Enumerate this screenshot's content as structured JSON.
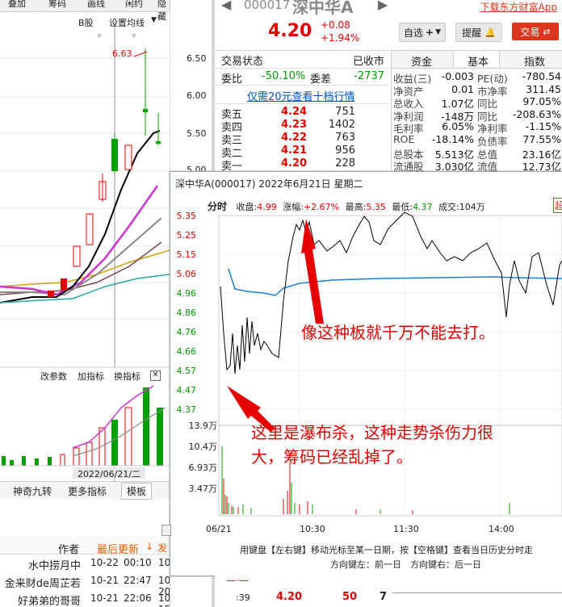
{
  "left": {
    "top_tabs": [
      "叠加",
      "筹码",
      "画线",
      "闲约",
      "隐藏"
    ],
    "b_label": "B股",
    "set_ma_label": "设置均线",
    "price_ticks": [
      "6.50",
      "6.00",
      "5.50",
      "5.00"
    ],
    "high_label": "6.63",
    "indicator_tabs": [
      "改参数",
      "加指标",
      "换指标"
    ],
    "date_label": "2022/06/21/二",
    "bottom_tabs": [
      "神奇九转",
      "更多指标",
      "模板"
    ],
    "comments_header": {
      "author": "作者",
      "latest": "最后更新"
    },
    "comments": [
      {
        "author": "水中捞月中",
        "date": "10-22",
        "time": "00:10",
        "extra": "10-"
      },
      {
        "author": "金来财de周芷若",
        "date": "10-21",
        "time": "22:47",
        "extra": "10-20"
      },
      {
        "author": "好弟弟的哥哥",
        "date": "10-21",
        "time": "22:06",
        "extra": "10-15"
      }
    ]
  },
  "header": {
    "code": "000017",
    "name": "深中华A",
    "download": "下载东方财富App",
    "price": "4.20",
    "change": "+0.08",
    "change_pct": "+1.94%",
    "btn_watch": "自选",
    "btn_alert": "提醒",
    "btn_trade": "交易"
  },
  "status": {
    "label": "交易状态",
    "value": "已收市",
    "wei_bi_label": "委比",
    "wei_bi": "-50.10%",
    "wei_cha_label": "委差",
    "wei_cha": "-2737",
    "link": "仅需20元查看十档行情"
  },
  "asks": [
    {
      "label": "卖五",
      "price": "4.24",
      "vol": "751"
    },
    {
      "label": "卖四",
      "price": "4.23",
      "vol": "1402"
    },
    {
      "label": "卖三",
      "price": "4.22",
      "vol": "763"
    },
    {
      "label": "卖二",
      "price": "4.21",
      "vol": "956"
    },
    {
      "label": "卖一",
      "price": "4.20",
      "vol": "228"
    }
  ],
  "info_tabs": [
    "资金",
    "基本",
    "指数"
  ],
  "fundamentals": [
    {
      "k1": "收益(三)",
      "v1": "-0.003",
      "k2": "PE(动)",
      "v2": "-780.54"
    },
    {
      "k1": "净资产",
      "v1": "0.01",
      "k2": "市净率",
      "v2": "311.45"
    },
    {
      "k1": "总收入",
      "v1": "1.07亿",
      "k2": "同比",
      "v2": "97.05%"
    },
    {
      "k1": "净利润",
      "v1": "-148万",
      "k2": "同比",
      "v2": "-208.63%"
    },
    {
      "k1": "毛利率",
      "v1": "6.05%",
      "k2": "净利率",
      "v2": "-1.15%"
    },
    {
      "k1": "ROE",
      "v1": "-18.14%",
      "k2": "负债率",
      "v2": "77.55%"
    },
    {
      "k1": "总股本",
      "v1": "5.513亿",
      "k2": "总值",
      "v2": "23.16亿"
    },
    {
      "k1": "流通股",
      "v1": "3.030亿",
      "k2": "流值",
      "v2": "12.73亿"
    }
  ],
  "popup": {
    "title": "深中华A(000017) 2022年6月21日 星期二",
    "fenshi": "分时",
    "close_label": "收盘:",
    "close": "4.99",
    "chg_label": "涨幅:",
    "chg": "+2.67%",
    "high_label": "最高:",
    "high": "5.35",
    "low_label": "最低:",
    "low": "4.37",
    "vol_label": "成交:",
    "vol": "104万",
    "y_ticks": [
      "5.35",
      "5.25",
      "5.15",
      "5.06",
      "4.96",
      "4.86",
      "4.76",
      "4.66",
      "4.57",
      "4.47",
      "4.37"
    ],
    "vol_ticks": [
      "13.9万",
      "10.4万",
      "6.93万",
      "3.47万"
    ],
    "x_ticks": [
      "06/21",
      "10:30",
      "11:30",
      "14:00"
    ],
    "annotation1": "像这种板就千万不能去打。",
    "annotation2_line1": "这里是瀑布杀，这种走势杀伤力很",
    "annotation2_line2": "大，筹码已经乱掉了。",
    "footer1": "用键盘【左右键】移动光标至某一日期，按【空格键】查看当日历史分时走",
    "footer2": "方向键左：前一日　方向键右：后一日",
    "corner": "超"
  },
  "trade_row": {
    "time": ":39",
    "price": "4.20",
    "vol": "50",
    "n": "7"
  },
  "colors": {
    "up": "#e60000",
    "down": "#009900",
    "accent": "#d9351f",
    "link": "#0050c8"
  }
}
